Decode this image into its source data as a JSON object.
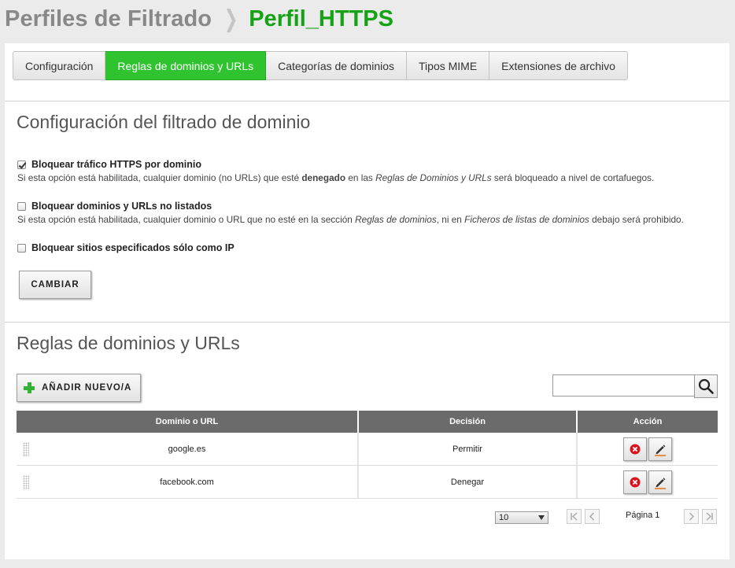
{
  "header": {
    "parent": "Perfiles de Filtrado",
    "separator": "❯",
    "current": "Perfil_HTTPS"
  },
  "tabs": [
    {
      "label": "Configuración",
      "active": false
    },
    {
      "label": "Reglas de dominios y URLs",
      "active": true
    },
    {
      "label": "Categorías de dominios",
      "active": false
    },
    {
      "label": "Tipos MIME",
      "active": false
    },
    {
      "label": "Extensiones de archivo",
      "active": false
    }
  ],
  "config": {
    "title": "Configuración del filtrado de dominio",
    "options": [
      {
        "label": "Bloquear tráfico HTTPS por dominio",
        "checked": true,
        "help_parts": [
          {
            "t": "Si esta opción está habilitada, cualquier dominio (no URLs) que esté "
          },
          {
            "t": "denegado",
            "b": true
          },
          {
            "t": " en las "
          },
          {
            "t": "Reglas de Dominios y URLs",
            "i": true
          },
          {
            "t": " será bloqueado a nivel de cortafuegos."
          }
        ]
      },
      {
        "label": "Bloquear dominios y URLs no listados",
        "checked": false,
        "help_parts": [
          {
            "t": "Si esta opción está habilitada, cualquier dominio o URL que no esté en la sección "
          },
          {
            "t": "Reglas de dominios",
            "i": true
          },
          {
            "t": ", ni en "
          },
          {
            "t": "Ficheros de listas de dominios",
            "i": true
          },
          {
            "t": " debajo será prohibido."
          }
        ]
      },
      {
        "label": "Bloquear sitios especificados sólo como IP",
        "checked": false,
        "help_parts": []
      }
    ],
    "submit_label": "CAMBIAR"
  },
  "rules": {
    "title": "Reglas de dominios y URLs",
    "add_label": "AÑADIR NUEVO/A",
    "search_value": "",
    "columns": [
      "Dominio o URL",
      "Decisión",
      "Acción"
    ],
    "rows": [
      {
        "domain": "google.es",
        "decision": "Permitir"
      },
      {
        "domain": "facebook.com",
        "decision": "Denegar"
      }
    ],
    "page_size": "10",
    "page_label": "Página 1"
  },
  "colors": {
    "accent": "#2fc42f",
    "title_current": "#15a315",
    "delete": "#d9141c",
    "edit_underline": "#e8761a"
  }
}
